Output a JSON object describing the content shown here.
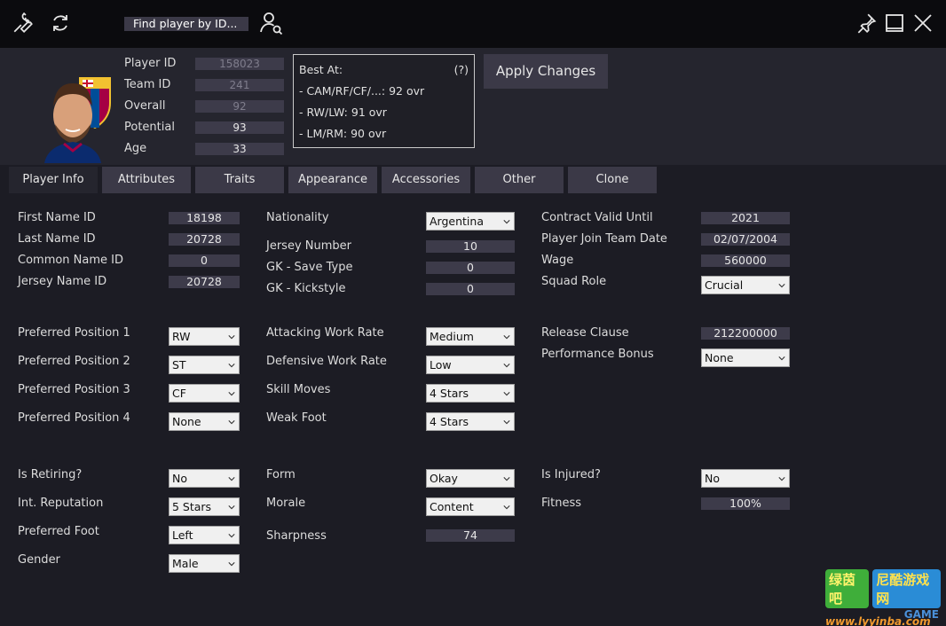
{
  "titlebar": {
    "find_label": "Find player by ID...",
    "icons": [
      "wrench-icon",
      "refresh-icon",
      "user-search-icon",
      "pin-icon",
      "minimize-icon",
      "close-icon"
    ]
  },
  "header": {
    "fields": [
      {
        "label": "Player ID",
        "value": "158023"
      },
      {
        "label": "Team ID",
        "value": "241"
      },
      {
        "label": "Overall",
        "value": "92"
      },
      {
        "label": "Potential",
        "value": "93"
      },
      {
        "label": "Age",
        "value": "33"
      }
    ],
    "best_at": {
      "title": "Best At:",
      "help": "(?)",
      "lines": [
        "- CAM/RF/CF/...: 92 ovr",
        "- RW/LW: 91 ovr",
        "- LM/RM: 90 ovr"
      ]
    },
    "apply_label": "Apply Changes"
  },
  "tabs": [
    "Player Info",
    "Attributes",
    "Traits",
    "Appearance",
    "Accessories",
    "Other",
    "Clone"
  ],
  "col1": {
    "ids": [
      {
        "label": "First Name ID",
        "value": "18198"
      },
      {
        "label": "Last Name ID",
        "value": "20728"
      },
      {
        "label": "Common Name ID",
        "value": "0"
      },
      {
        "label": "Jersey Name ID",
        "value": "20728"
      }
    ],
    "positions": [
      {
        "label": "Preferred Position 1",
        "value": "RW"
      },
      {
        "label": "Preferred Position 2",
        "value": "ST"
      },
      {
        "label": "Preferred Position 3",
        "value": "CF"
      },
      {
        "label": "Preferred Position 4",
        "value": "None"
      }
    ],
    "misc": [
      {
        "label": "Is Retiring?",
        "value": "No"
      },
      {
        "label": "Int. Reputation",
        "value": "5 Stars"
      },
      {
        "label": "Preferred Foot",
        "value": "Left"
      },
      {
        "label": "Gender",
        "value": "Male"
      }
    ]
  },
  "col2": {
    "nationality": {
      "label": "Nationality",
      "value": "Argentina"
    },
    "numbers": [
      {
        "label": "Jersey Number",
        "value": "10"
      },
      {
        "label": "GK - Save Type",
        "value": "0"
      },
      {
        "label": "GK - Kickstyle",
        "value": "0"
      }
    ],
    "work": [
      {
        "label": "Attacking Work Rate",
        "value": "Medium"
      },
      {
        "label": "Defensive Work Rate",
        "value": "Low"
      },
      {
        "label": "Skill Moves",
        "value": "4 Stars"
      },
      {
        "label": "Weak Foot",
        "value": "4 Stars"
      }
    ],
    "form": {
      "label": "Form",
      "value": "Okay"
    },
    "morale": {
      "label": "Morale",
      "value": "Content"
    },
    "sharpness": {
      "label": "Sharpness",
      "value": "74"
    }
  },
  "col3": {
    "contract": [
      {
        "label": "Contract Valid Until",
        "value": "2021"
      },
      {
        "label": "Player Join Team Date",
        "value": "02/07/2004"
      },
      {
        "label": "Wage",
        "value": "560000"
      }
    ],
    "squad_role": {
      "label": "Squad Role",
      "value": "Crucial"
    },
    "release": {
      "label": "Release Clause",
      "value": "212200000"
    },
    "bonus": {
      "label": "Performance Bonus",
      "value": "None"
    },
    "injured": {
      "label": "Is Injured?",
      "value": "No"
    },
    "fitness": {
      "label": "Fitness",
      "value": "100%"
    }
  },
  "watermark": {
    "text1": "绿茵吧",
    "text2": "尼酷游戏网",
    "url": "www.lyyinba.com",
    "brand": "GAME"
  }
}
